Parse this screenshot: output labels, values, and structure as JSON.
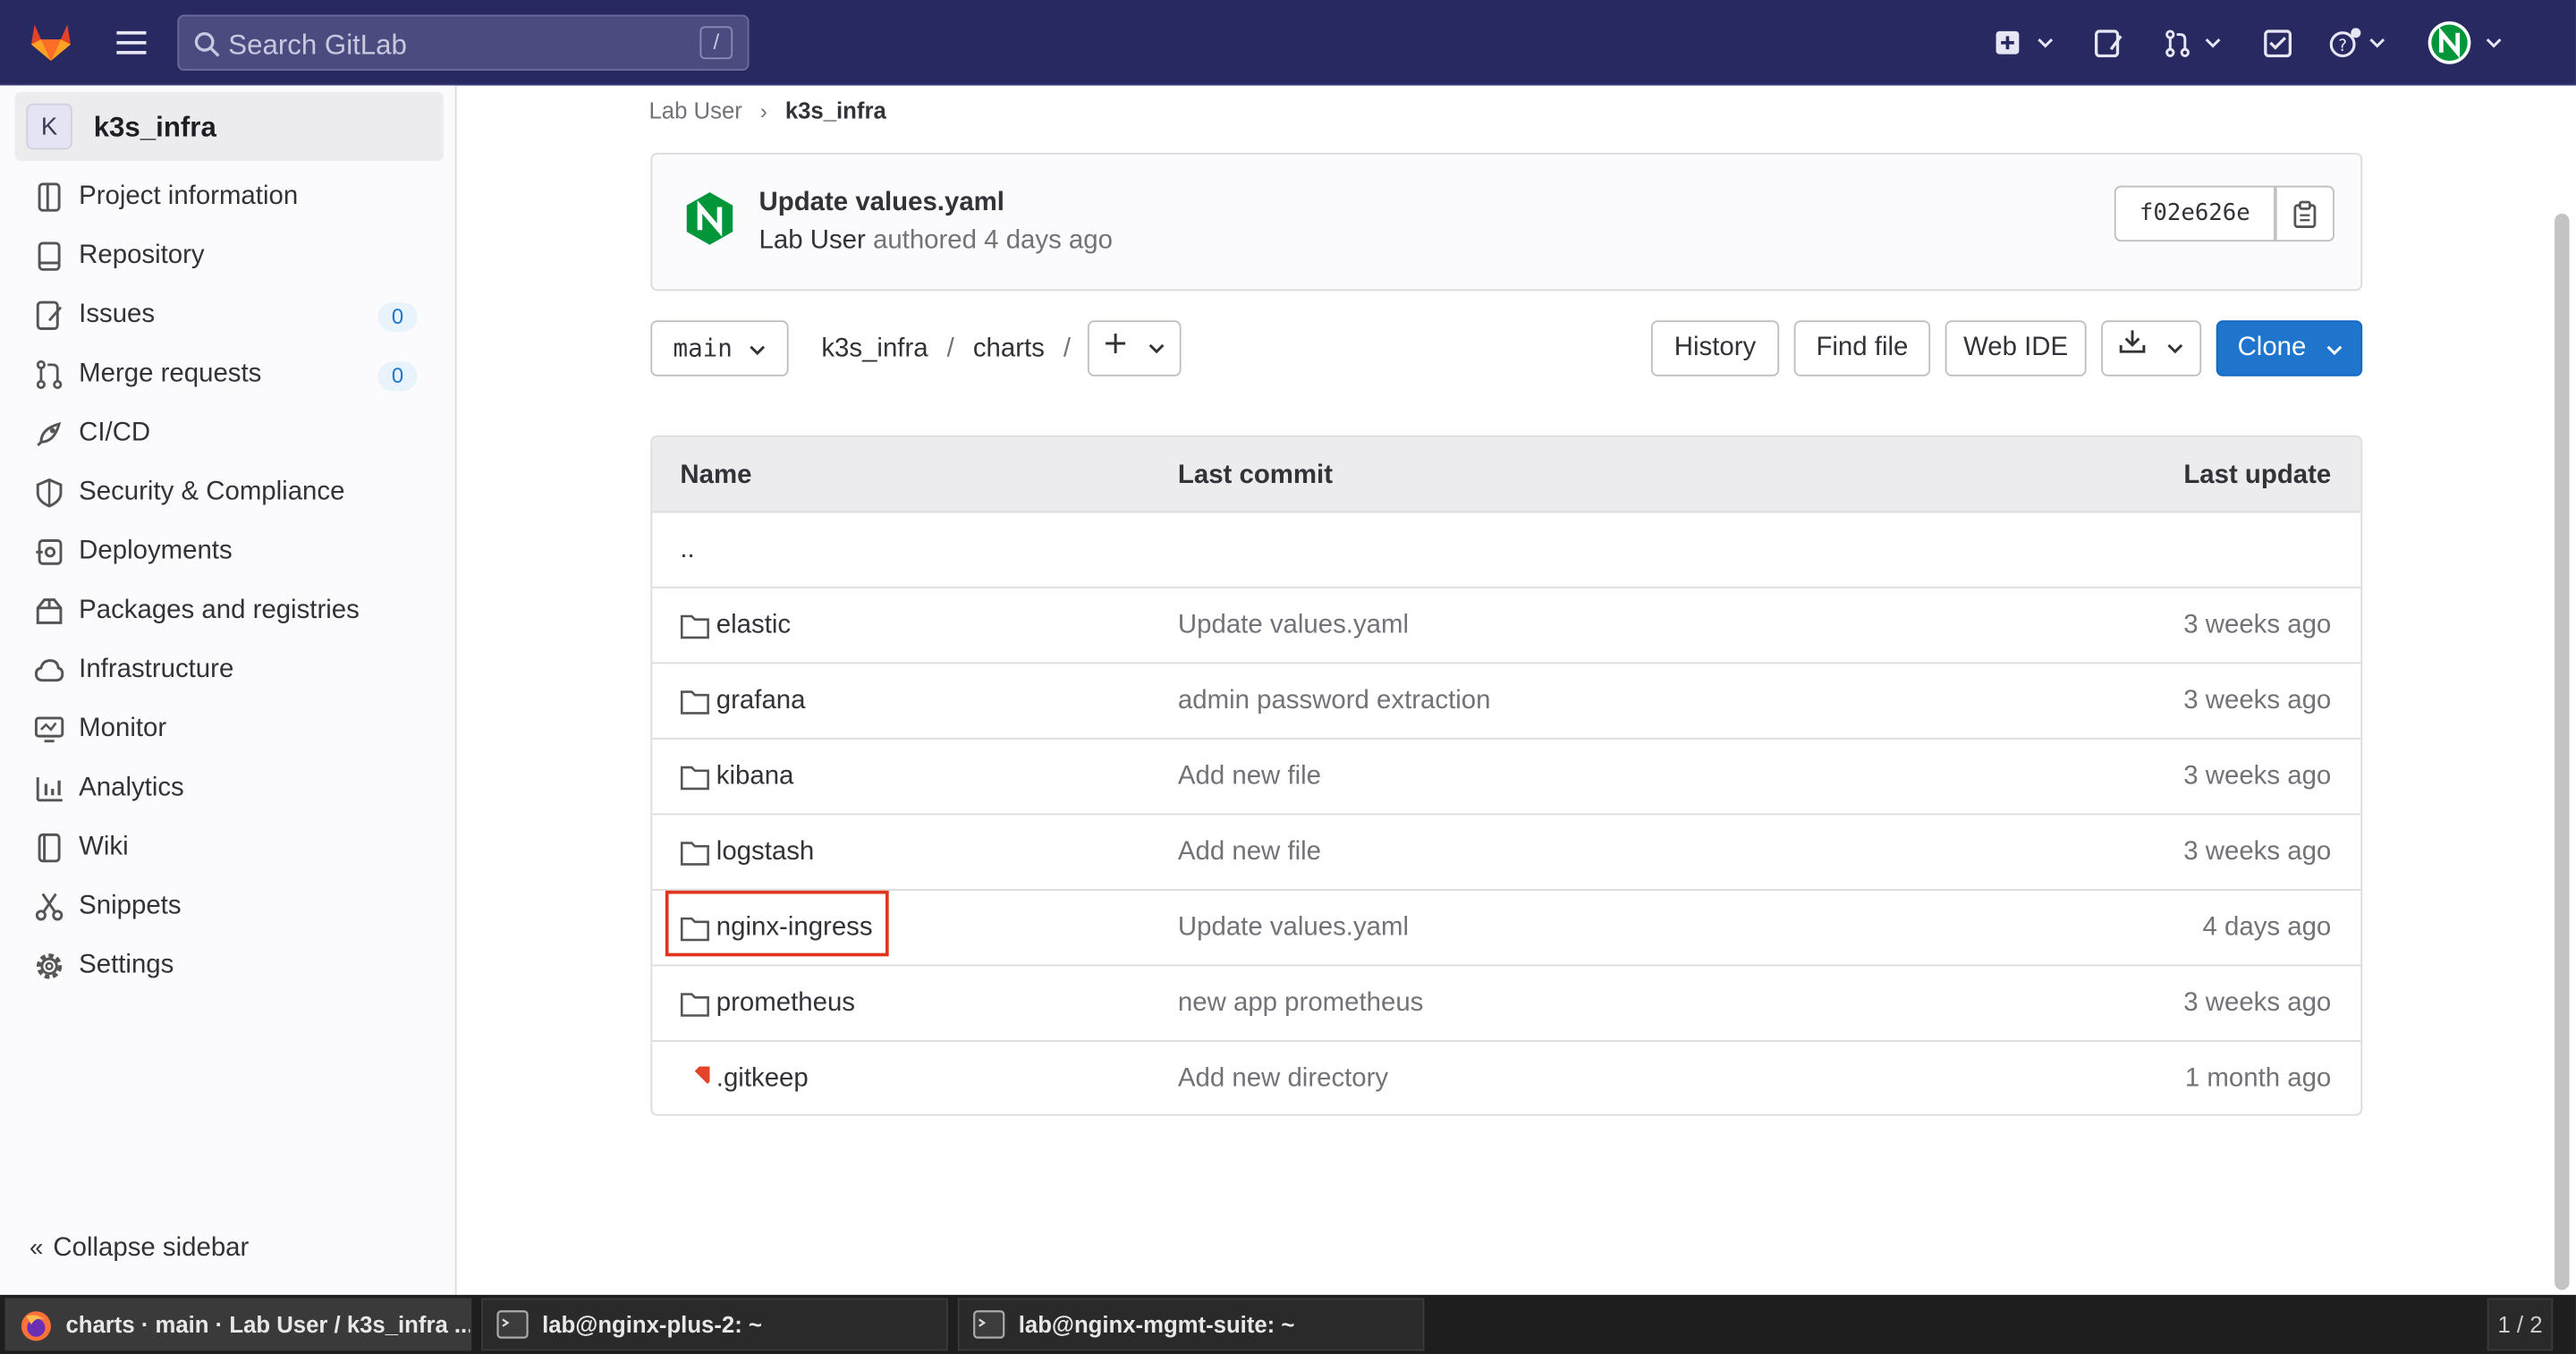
{
  "search": {
    "placeholder": "Search GitLab",
    "shortcut": "/"
  },
  "project": {
    "avatar": "K",
    "name": "k3s_infra"
  },
  "sidebar": {
    "items": [
      {
        "label": "Project information",
        "icon": "info-icon"
      },
      {
        "label": "Repository",
        "icon": "book-icon"
      },
      {
        "label": "Issues",
        "icon": "issues-icon",
        "count": "0"
      },
      {
        "label": "Merge requests",
        "icon": "merge-request-icon",
        "count": "0"
      },
      {
        "label": "CI/CD",
        "icon": "rocket-icon"
      },
      {
        "label": "Security & Compliance",
        "icon": "shield-icon"
      },
      {
        "label": "Deployments",
        "icon": "deployments-icon"
      },
      {
        "label": "Packages and registries",
        "icon": "package-icon"
      },
      {
        "label": "Infrastructure",
        "icon": "cloud-icon"
      },
      {
        "label": "Monitor",
        "icon": "monitor-icon"
      },
      {
        "label": "Analytics",
        "icon": "chart-icon"
      },
      {
        "label": "Wiki",
        "icon": "wiki-icon"
      },
      {
        "label": "Snippets",
        "icon": "snippet-icon"
      },
      {
        "label": "Settings",
        "icon": "gear-icon"
      }
    ],
    "collapse": "Collapse sidebar"
  },
  "breadcrumb": {
    "parent": "Lab User",
    "current": "k3s_infra"
  },
  "commit": {
    "title": "Update values.yaml",
    "author": "Lab User",
    "authored": "authored",
    "time": "4 days ago",
    "sha": "f02e626e"
  },
  "toolbar": {
    "branch": "main",
    "path_root": "k3s_infra",
    "path_sep": "/",
    "path_dir": "charts",
    "history": "History",
    "find_file": "Find file",
    "web_ide": "Web IDE",
    "clone": "Clone"
  },
  "table": {
    "headers": {
      "name": "Name",
      "commit": "Last commit",
      "update": "Last update"
    },
    "parent": "..",
    "rows": [
      {
        "name": "elastic",
        "commit": "Update values.yaml",
        "update": "3 weeks ago",
        "type": "folder"
      },
      {
        "name": "grafana",
        "commit": "admin password extraction",
        "update": "3 weeks ago",
        "type": "folder"
      },
      {
        "name": "kibana",
        "commit": "Add new file",
        "update": "3 weeks ago",
        "type": "folder"
      },
      {
        "name": "logstash",
        "commit": "Add new file",
        "update": "3 weeks ago",
        "type": "folder"
      },
      {
        "name": "nginx-ingress",
        "commit": "Update values.yaml",
        "update": "4 days ago",
        "type": "folder"
      },
      {
        "name": "prometheus",
        "commit": "new app prometheus",
        "update": "3 weeks ago",
        "type": "folder"
      },
      {
        "name": ".gitkeep",
        "commit": "Add new directory",
        "update": "1 month ago",
        "type": "file"
      }
    ]
  },
  "taskbar": {
    "tasks": [
      "charts · main · Lab User / k3s_infra ...",
      "lab@nginx-plus-2: ~",
      "lab@nginx-mgmt-suite: ~"
    ],
    "workspace": "1 / 2"
  },
  "colors": {
    "topbar": "#292961",
    "accent": "#1f75cb",
    "highlight": "#e0341f",
    "nginx_green": "#009639"
  }
}
